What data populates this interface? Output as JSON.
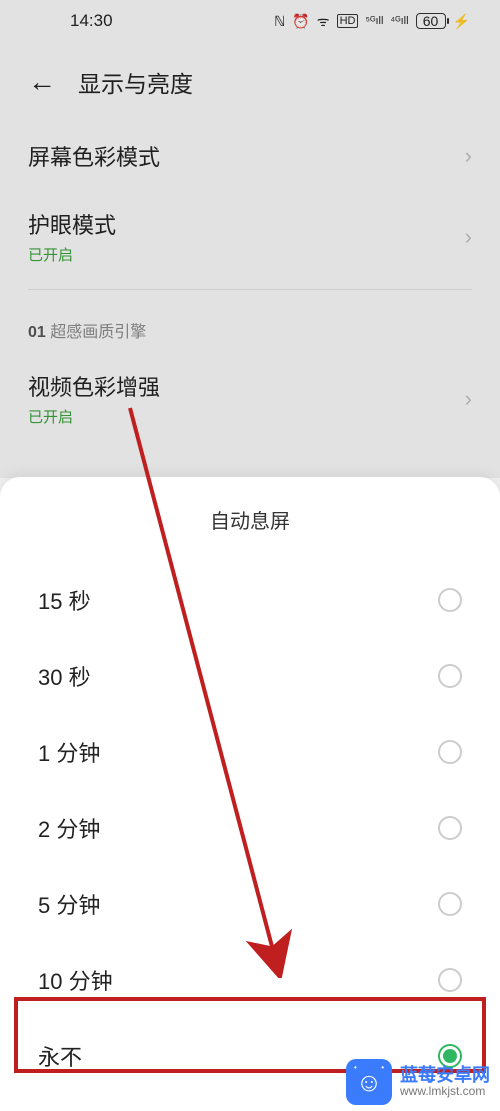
{
  "status": {
    "time": "14:30",
    "battery": "60"
  },
  "nav": {
    "title": "显示与亮度"
  },
  "settings": {
    "color_mode": {
      "title": "屏幕色彩模式"
    },
    "eye_care": {
      "title": "护眼模式",
      "status": "已开启"
    },
    "section": {
      "num": "01",
      "label": "超感画质引擎"
    },
    "video_color": {
      "title": "视频色彩增强",
      "status": "已开启"
    }
  },
  "sheet": {
    "title": "自动息屏",
    "options": [
      {
        "label": "15 秒",
        "selected": false
      },
      {
        "label": "30 秒",
        "selected": false
      },
      {
        "label": "1 分钟",
        "selected": false
      },
      {
        "label": "2 分钟",
        "selected": false
      },
      {
        "label": "5 分钟",
        "selected": false
      },
      {
        "label": "10 分钟",
        "selected": false
      },
      {
        "label": "永不",
        "selected": true
      }
    ]
  },
  "watermark": {
    "title": "蓝莓安卓网",
    "url": "www.lmkjst.com"
  }
}
